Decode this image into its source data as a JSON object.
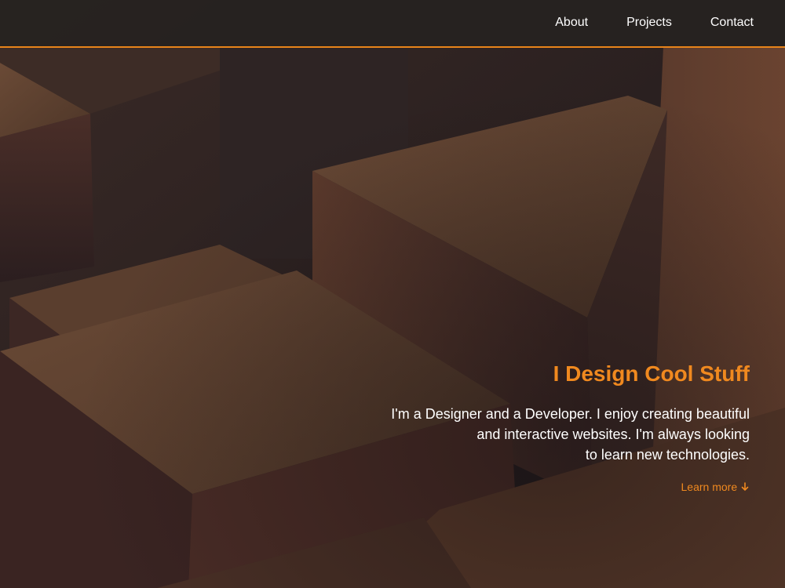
{
  "nav": {
    "items": [
      {
        "label": "About"
      },
      {
        "label": "Projects"
      },
      {
        "label": "Contact"
      }
    ]
  },
  "hero": {
    "title": "I Design Cool Stuff",
    "lines": [
      "I'm a Designer and a Developer. I enjoy creating beautiful",
      "and interactive websites. I'm always looking",
      "to learn new technologies."
    ],
    "cta_label": "Learn more",
    "cta_icon": "arrow-down-icon"
  },
  "colors": {
    "accent": "#f0891f",
    "nav_background": "#262220",
    "text": "#ffffff"
  }
}
